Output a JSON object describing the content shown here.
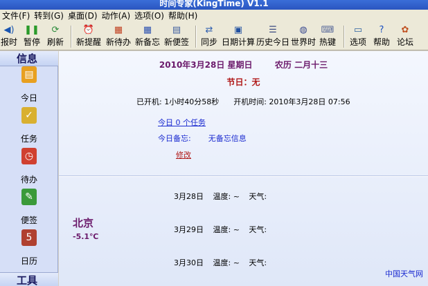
{
  "window": {
    "title": "时间专家(KingTime) V1.1"
  },
  "menu": [
    "文件(F)",
    "转到(G)",
    "桌面(D)",
    "动作(A)",
    "选项(O)",
    "帮助(H)"
  ],
  "toolbar": [
    {
      "label": "报时",
      "icon": "speaker-icon"
    },
    {
      "label": "暂停",
      "icon": "pause-icon"
    },
    {
      "label": "刷新",
      "icon": "refresh-icon"
    },
    {
      "label": "新提醒",
      "icon": "alarm-clock-icon"
    },
    {
      "label": "新待办",
      "icon": "calendar-clock-icon"
    },
    {
      "label": "新备忘",
      "icon": "grid-icon"
    },
    {
      "label": "新便签",
      "icon": "note-icon"
    },
    {
      "label": "同步",
      "icon": "sync-icon"
    },
    {
      "label": "日期计算",
      "icon": "calculator-icon"
    },
    {
      "label": "历史今日",
      "icon": "history-icon"
    },
    {
      "label": "世界时",
      "icon": "globe-icon"
    },
    {
      "label": "热键",
      "icon": "hotkey-icon"
    },
    {
      "label": "选项",
      "icon": "options-icon"
    },
    {
      "label": "帮助",
      "icon": "help-icon"
    },
    {
      "label": "论坛",
      "icon": "forum-icon"
    }
  ],
  "sidebar": {
    "header": "信息",
    "footer_header": "工具",
    "items": [
      {
        "label": "今日",
        "icon": "clipboard-icon",
        "color": "#e8a020"
      },
      {
        "label": "任务",
        "icon": "task-icon",
        "color": "#d9b030"
      },
      {
        "label": "待办",
        "icon": "todo-icon",
        "color": "#d04030"
      },
      {
        "label": "便签",
        "icon": "sticky-note-icon",
        "color": "#3a9a3a"
      },
      {
        "label": "日历",
        "icon": "calendar-icon",
        "color": "#b04030"
      }
    ]
  },
  "today": {
    "date": "2010年3月28日  星期日",
    "lunar": "农历  二月十三",
    "holiday": "节日：无",
    "uptime_label": "已开机: 1小时40分58秒",
    "boot_label": "开机时间: 2010年3月28日 07:56",
    "tasks_link": "今日 0 个任务",
    "memo_label": "今日备忘:",
    "memo_value": "无备忘信息",
    "edit_link": "修改"
  },
  "weather": {
    "city": "北京",
    "temp": "-5.1℃",
    "days": [
      {
        "date": "3月28日",
        "temp": "温度: ~",
        "weather": "天气:"
      },
      {
        "date": "3月29日",
        "temp": "温度: ~",
        "weather": "天气:"
      },
      {
        "date": "3月30日",
        "temp": "温度: ~",
        "weather": "天气:"
      }
    ],
    "source_link": "中国天气网"
  }
}
